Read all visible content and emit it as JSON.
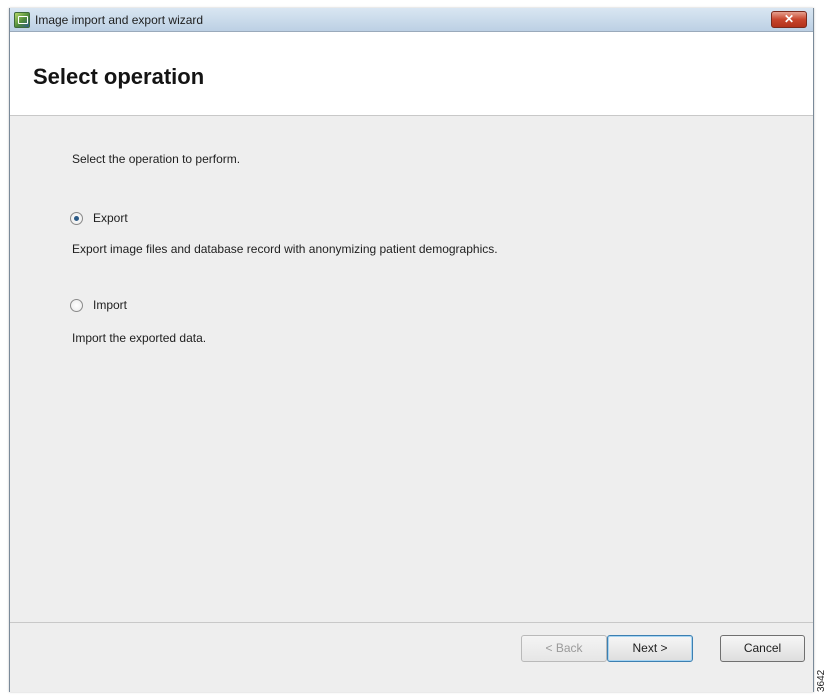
{
  "window": {
    "title": "Image import and export wizard",
    "close_label": "✕"
  },
  "header": {
    "title": "Select operation"
  },
  "content": {
    "prompt": "Select the operation to perform.",
    "options": [
      {
        "label": "Export",
        "selected": true,
        "description": "Export image files and database record with anonymizing patient demographics."
      },
      {
        "label": "Import",
        "selected": false,
        "description": "Import the exported data."
      }
    ]
  },
  "footer": {
    "back_label": "< Back",
    "next_label": "Next >",
    "cancel_label": "Cancel"
  },
  "side_note": "3642"
}
